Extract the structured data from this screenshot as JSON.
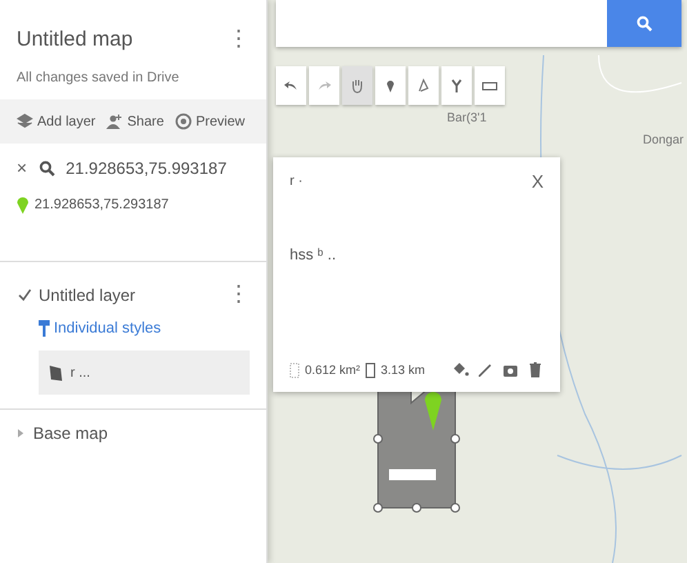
{
  "sidebar": {
    "title": "Untitled map",
    "menu": "⋮",
    "subtitle": "All changes saved in Drive",
    "actions": [
      {
        "kind": "layer",
        "label": "Add layer"
      },
      {
        "kind": "share",
        "label": "Share"
      },
      {
        "kind": "preview",
        "label": "Preview"
      }
    ],
    "search_result": {
      "close": "×",
      "query": "21.928653,75.993187",
      "place": "21.928653,75.293187"
    },
    "layer": {
      "name": "Untitled layer",
      "menu": "⋮",
      "checked": true,
      "style": "Individual styles",
      "feature": "r ..."
    },
    "base_map": {
      "label": "Base map",
      "expanded": false
    }
  },
  "map": {
    "labels": [
      {
        "text": "Bar(3'1"
      },
      {
        "text": "Dongar"
      }
    ],
    "tools": [
      {
        "kind": "undo",
        "selected": false
      },
      {
        "kind": "redo",
        "selected": false
      },
      {
        "kind": "hand",
        "selected": true
      },
      {
        "kind": "marker",
        "selected": false
      },
      {
        "kind": "line",
        "selected": false
      },
      {
        "kind": "route",
        "selected": false
      },
      {
        "kind": "ruler",
        "selected": false
      }
    ]
  },
  "popup": {
    "close": "X",
    "title": "r ·",
    "description": "hss ᵇ ..",
    "area": "0.612 km²",
    "perimeter": "3.13 km"
  }
}
